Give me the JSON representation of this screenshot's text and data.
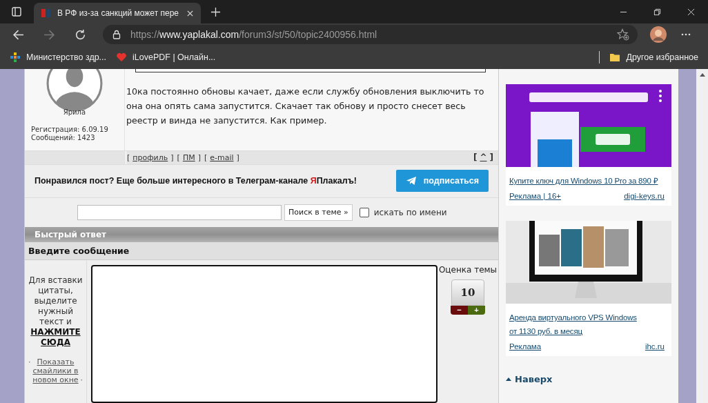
{
  "browser": {
    "tab_title": "В РФ из-за санкций может пере",
    "url_scheme": "https://",
    "url_host": "www.yaplakal.com",
    "url_path": "/forum3/st/50/topic2400956.html",
    "bookmarks": [
      {
        "label": "Министерство здр...",
        "kind": "grid"
      },
      {
        "label": "iLovePDF | Онлайн...",
        "kind": "heart"
      }
    ],
    "other_bookmarks": "Другое избранное"
  },
  "post": {
    "author": "Ярила",
    "registration": "Регистрация: 6.09.19",
    "messages": "Сообщений: 1423",
    "text": "10ка постоянно обновы качает, даже если службу обновления выключить то она она опять сама запустится. Скачает так обнову и просто снесет весь реестр и винда не запустится. Как пример.",
    "links": [
      "профиль",
      "ПМ",
      "e-mail"
    ],
    "top_link": "^",
    "bracket_open": "[",
    "bracket_close": "]"
  },
  "telegram": {
    "text": "Понравился пост? Еще больше интересного в Телеграм-канале ",
    "brand_first": "Я",
    "brand_rest": "Плакалъ!",
    "button": "подписаться"
  },
  "search": {
    "button": "Поиск в теме »",
    "by_name": {
      "label": "искать по имени",
      "checked": false
    }
  },
  "quick_reply": {
    "title": "Быстрый ответ",
    "subtitle": "Введите сообщение",
    "hint": "Для вставки цитаты, выделите нужный текст и",
    "hint_link": "НАЖМИТЕ СЮДА",
    "smileys_link": "Показать смайлики в новом окне",
    "bullet": "·",
    "rating_label": "Оценка темы",
    "rating": "10",
    "minus": "−",
    "plus": "+"
  },
  "ads": [
    {
      "title_lines": [
        "Купите ключ для Windows 10 Pro за 890 ₽"
      ],
      "label": "Реклама | 16+",
      "domain": "digi-keys.ru",
      "kind": "purple"
    },
    {
      "title_lines": [
        "Аренда виртуального VPS Windows",
        "от 1130 руб. в месяц"
      ],
      "label": "Реклама",
      "domain": "ihc.ru",
      "kind": "monitor"
    }
  ],
  "to_top": "Наверх"
}
